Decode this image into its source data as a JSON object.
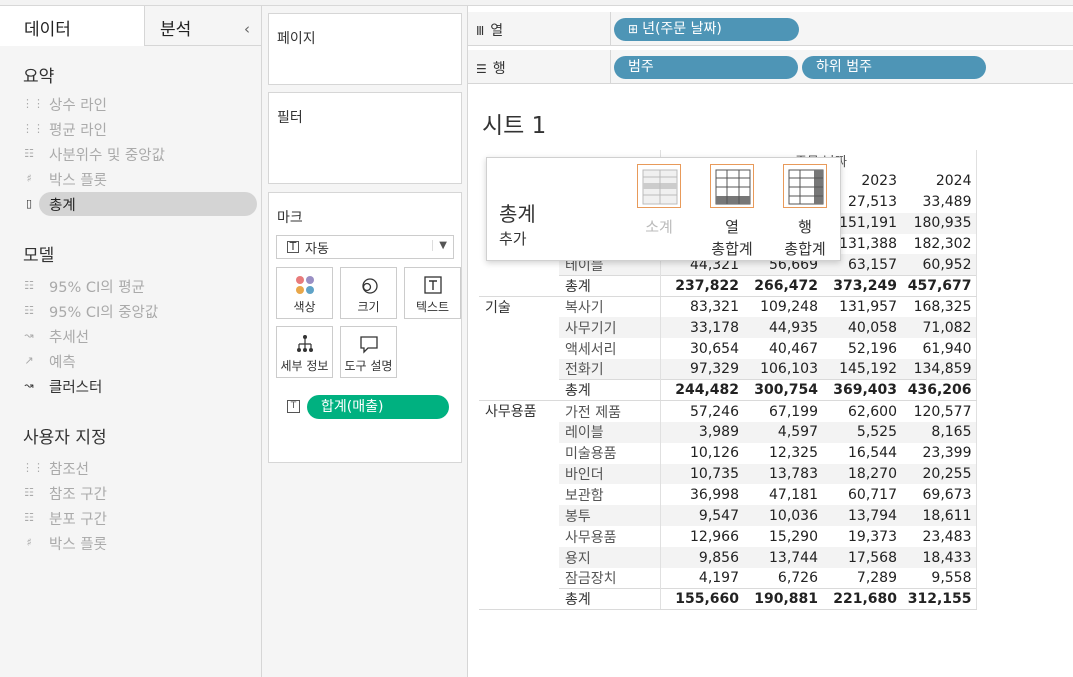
{
  "left_pane": {
    "tabs": {
      "data": "데이터",
      "analysis": "분석"
    },
    "sections": {
      "summary": {
        "title": "요약",
        "items": [
          "상수 라인",
          "평균 라인",
          "사분위수 및 중앙값",
          "박스 플롯",
          "총계"
        ]
      },
      "model": {
        "title": "모델",
        "items": [
          "95% CI의 평균",
          "95% CI의 중앙값",
          "추세선",
          "예측",
          "클러스터"
        ]
      },
      "custom": {
        "title": "사용자 지정",
        "items": [
          "참조선",
          "참조 구간",
          "분포 구간",
          "박스 플롯"
        ]
      }
    }
  },
  "middle_pane": {
    "pages": "페이지",
    "filters": "필터",
    "marks": {
      "title": "마크",
      "type": "자동",
      "buttons": [
        "색상",
        "크기",
        "텍스트",
        "세부 정보",
        "도구 설명"
      ],
      "measure_pill": "합계(매출)"
    }
  },
  "shelves": {
    "columns": {
      "label": "열",
      "pills": [
        "년(주문 날짜)"
      ]
    },
    "rows": {
      "label": "행",
      "pills": [
        "범주",
        "하위 범주"
      ]
    }
  },
  "view": {
    "sheet_title": "시트 1",
    "header_partial": "주문 날짜",
    "years": [
      "",
      "",
      "2023",
      "2024"
    ],
    "groups": [
      {
        "category": "",
        "rows": [
          {
            "sub": "",
            "values": [
              "",
              "",
              "27,513",
              "33,489"
            ]
          },
          {
            "sub": "",
            "values": [
              "",
              "",
              "151,191",
              "180,935"
            ]
          },
          {
            "sub": "",
            "values": [
              "",
              "",
              "131,388",
              "182,302"
            ]
          },
          {
            "sub": "테이블",
            "values": [
              "44,321",
              "56,669",
              "63,157",
              "60,952"
            ]
          }
        ],
        "total": {
          "label": "총계",
          "values": [
            "237,822",
            "266,472",
            "373,249",
            "457,677"
          ]
        }
      },
      {
        "category": "기술",
        "rows": [
          {
            "sub": "복사기",
            "values": [
              "83,321",
              "109,248",
              "131,957",
              "168,325"
            ]
          },
          {
            "sub": "사무기기",
            "values": [
              "33,178",
              "44,935",
              "40,058",
              "71,082"
            ]
          },
          {
            "sub": "액세서리",
            "values": [
              "30,654",
              "40,467",
              "52,196",
              "61,940"
            ]
          },
          {
            "sub": "전화기",
            "values": [
              "97,329",
              "106,103",
              "145,192",
              "134,859"
            ]
          }
        ],
        "total": {
          "label": "총계",
          "values": [
            "244,482",
            "300,754",
            "369,403",
            "436,206"
          ]
        }
      },
      {
        "category": "사무용품",
        "rows": [
          {
            "sub": "가전 제품",
            "values": [
              "57,246",
              "67,199",
              "62,600",
              "120,577"
            ]
          },
          {
            "sub": "레이블",
            "values": [
              "3,989",
              "4,597",
              "5,525",
              "8,165"
            ]
          },
          {
            "sub": "미술용품",
            "values": [
              "10,126",
              "12,325",
              "16,544",
              "23,399"
            ]
          },
          {
            "sub": "바인더",
            "values": [
              "10,735",
              "13,783",
              "18,270",
              "20,255"
            ]
          },
          {
            "sub": "보관함",
            "values": [
              "36,998",
              "47,181",
              "60,717",
              "69,673"
            ]
          },
          {
            "sub": "봉투",
            "values": [
              "9,547",
              "10,036",
              "13,794",
              "18,611"
            ]
          },
          {
            "sub": "사무용품",
            "values": [
              "12,966",
              "15,290",
              "19,373",
              "23,483"
            ]
          },
          {
            "sub": "용지",
            "values": [
              "9,856",
              "13,744",
              "17,568",
              "18,433"
            ]
          },
          {
            "sub": "잠금장치",
            "values": [
              "4,197",
              "6,726",
              "7,289",
              "9,558"
            ]
          }
        ],
        "total": {
          "label": "총계",
          "values": [
            "155,660",
            "190,881",
            "221,680",
            "312,155"
          ]
        }
      }
    ]
  },
  "popup": {
    "title": "총계",
    "subtitle": "추가",
    "options": [
      {
        "label1": "소계",
        "label2": ""
      },
      {
        "label1": "열",
        "label2": "총합계"
      },
      {
        "label1": "행",
        "label2": "총합계"
      }
    ]
  },
  "colors": {
    "pill_blue": "#4e95b6",
    "pill_green": "#00b180",
    "accent_orange": "#e89a5a"
  }
}
